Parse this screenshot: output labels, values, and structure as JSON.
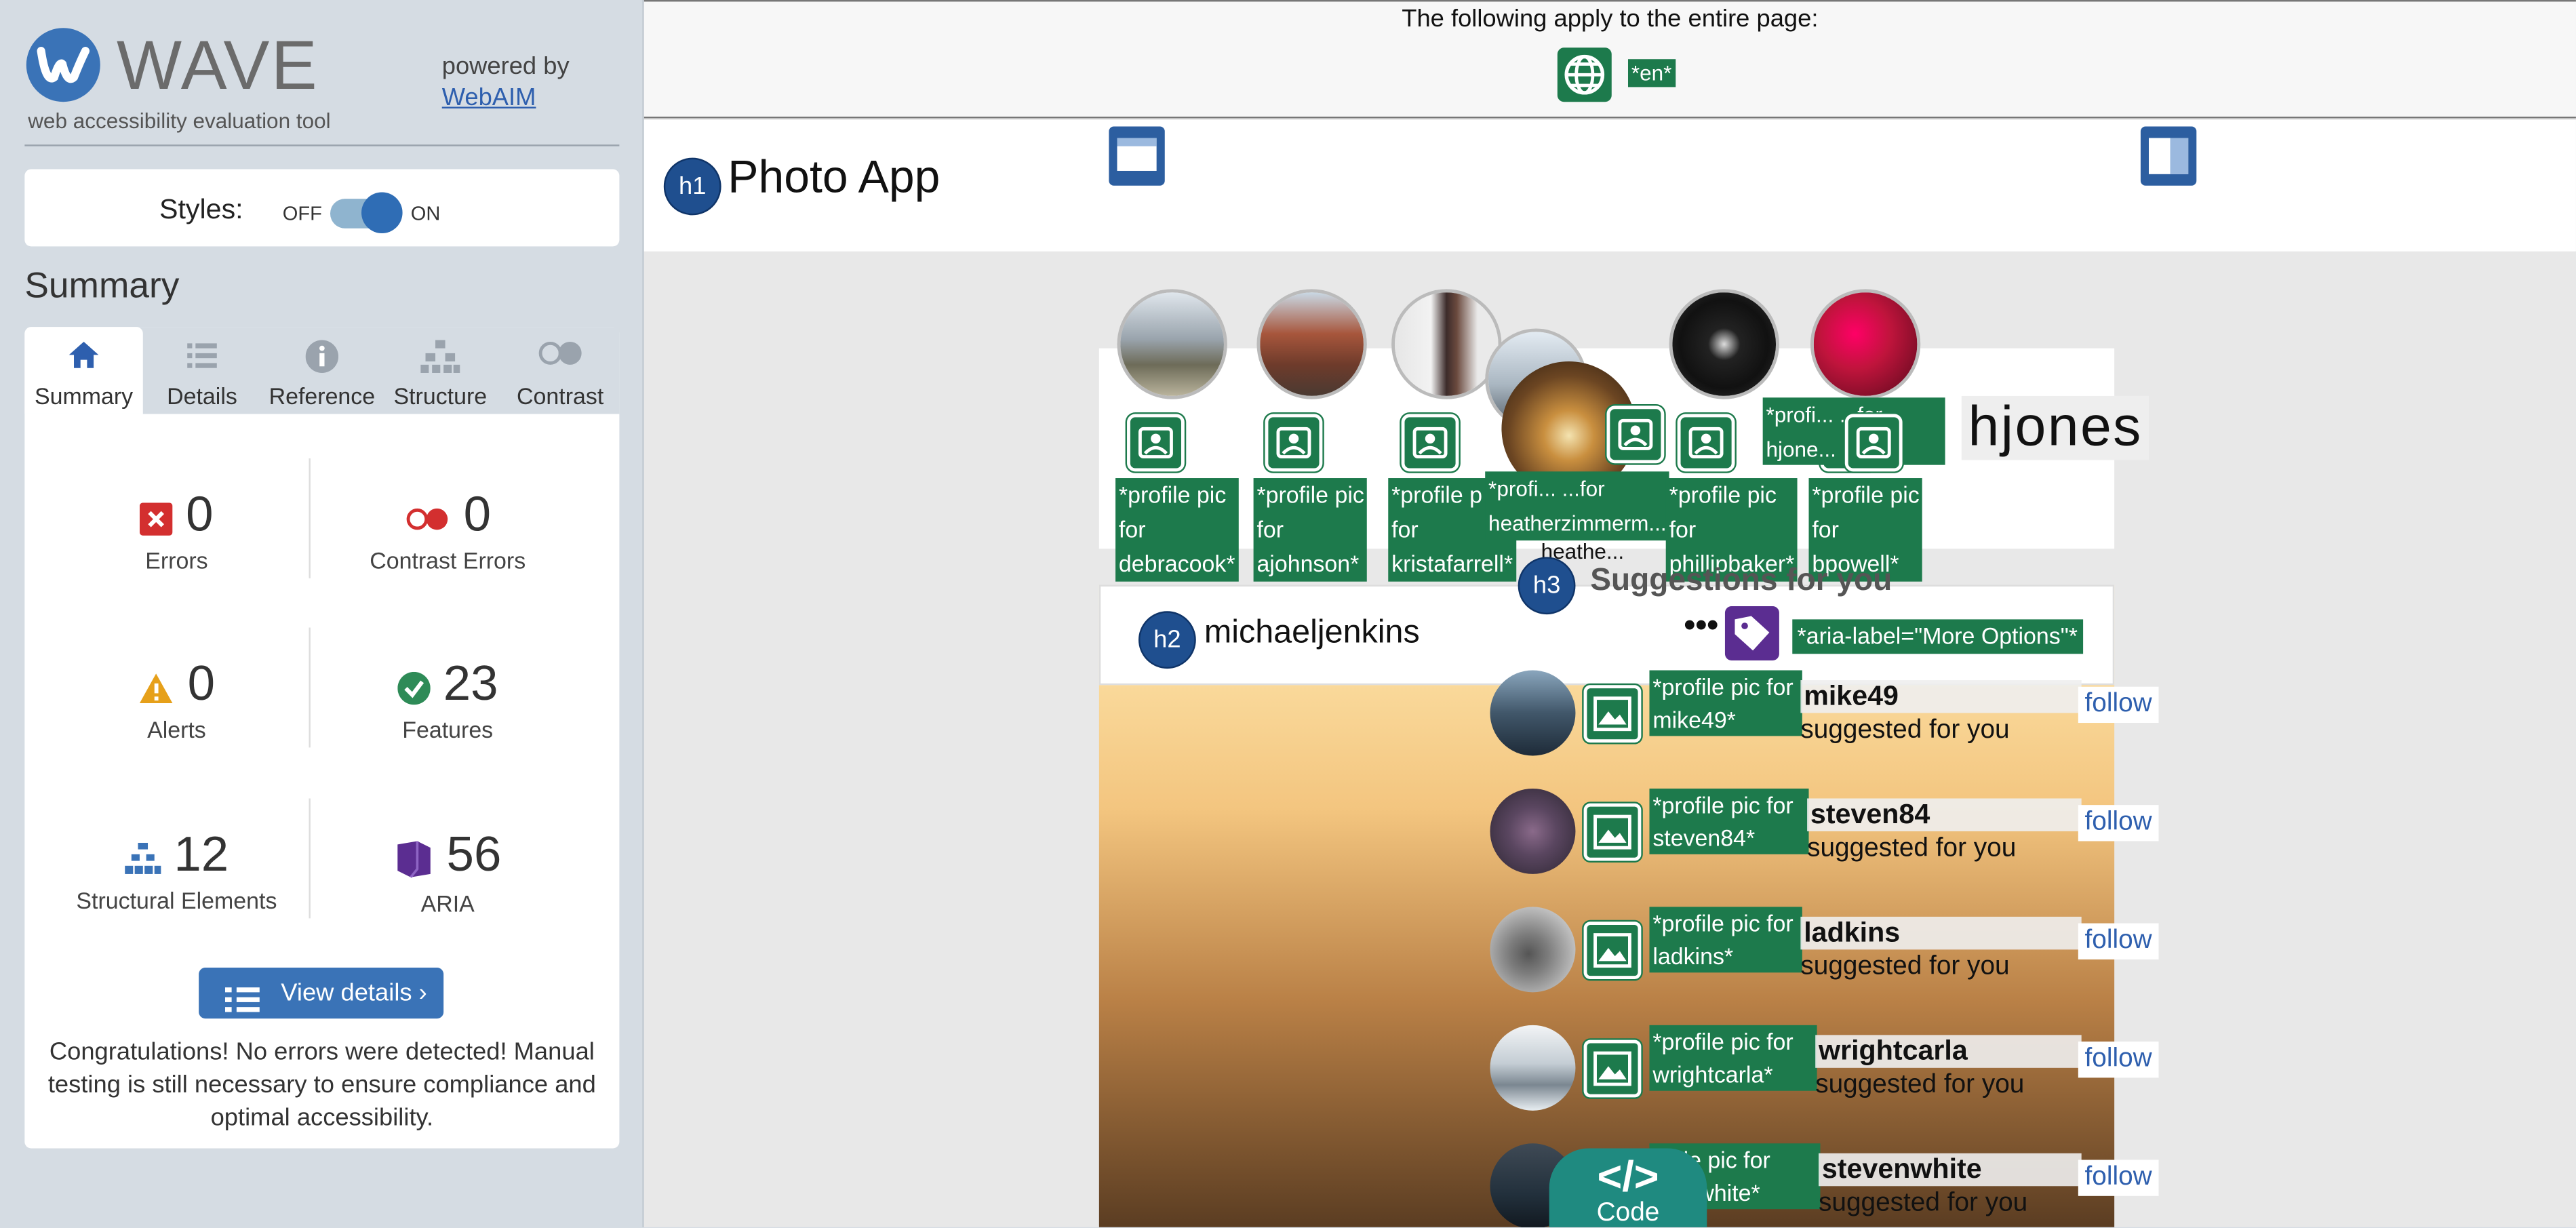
{
  "sidebar": {
    "title": "WAVE",
    "subtitle": "web accessibility evaluation tool",
    "powered_by": "powered by",
    "webaim_link": "WebAIM",
    "styles_label": "Styles:",
    "styles_off": "OFF",
    "styles_on": "ON",
    "styles_enabled": true,
    "summary_heading": "Summary",
    "tabs": [
      {
        "label": "Summary",
        "icon": "home-icon",
        "active": true
      },
      {
        "label": "Details",
        "icon": "list-icon",
        "active": false
      },
      {
        "label": "Reference",
        "icon": "info-icon",
        "active": false
      },
      {
        "label": "Structure",
        "icon": "hierarchy-icon",
        "active": false
      },
      {
        "label": "Contrast",
        "icon": "contrast-icon",
        "active": false
      }
    ],
    "stats": {
      "errors": {
        "value": "0",
        "label": "Errors",
        "color": "#d32f2f"
      },
      "contrast_errors": {
        "value": "0",
        "label": "Contrast Errors",
        "color": "#d32f2f"
      },
      "alerts": {
        "value": "0",
        "label": "Alerts",
        "color": "#e6a01a"
      },
      "features": {
        "value": "23",
        "label": "Features",
        "color": "#2e8b57"
      },
      "structural": {
        "value": "12",
        "label": "Structural Elements",
        "color": "#3a73b7"
      },
      "aria": {
        "value": "56",
        "label": "ARIA",
        "color": "#5b2d91"
      }
    },
    "view_details": "View details ›",
    "congrats": "Congratulations! No errors were detected! Manual testing is still necessary to ensure compliance and optimal accessibility."
  },
  "page": {
    "apply_text": "The following apply to the entire page:",
    "lang_tag": "*en*",
    "h1_badge": "h1",
    "app_title": "Photo App",
    "stories": [
      {
        "alt": "*profile pic for debracook*",
        "lines": [
          "*profile pic",
          "for",
          "debracook*"
        ]
      },
      {
        "alt": "*profile pic for ajohnson*",
        "lines": [
          "*profile pic",
          "for",
          "ajohnson*"
        ]
      },
      {
        "alt": "*profile pic for kristafarrell*",
        "lines": [
          "*profile p",
          "for",
          "kristafarrell*"
        ]
      },
      {
        "alt": "*profile pic for heatherzimmerman*",
        "lines": [
          "*profi... ...for",
          "heatherzimmerm..."
        ]
      },
      {
        "alt": "*profile pic for phillipbaker*",
        "lines": [
          "*profile pic",
          "for",
          "phillipbaker*"
        ]
      },
      {
        "alt": "*profile pic for bpowell*",
        "lines": [
          "*profile pic",
          "for",
          "bpowell*"
        ]
      }
    ],
    "hjones_label_lines": [
      "*profi... ...for",
      "hjone..."
    ],
    "hjones": "hjones",
    "heather_caption": "heathe...",
    "h3_badge": "h3",
    "suggestions_title": "Suggestions for you",
    "h2_badge": "h2",
    "post_user": "michaeljenkins",
    "more_options": "•••",
    "aria_label": "*aria-label=\"More Options\"*",
    "suggestions": [
      {
        "label_lines": [
          "*profile pic for",
          "mike49*"
        ],
        "name": "mike49",
        "sub": "suggested for you",
        "follow": "follow"
      },
      {
        "label_lines": [
          "*profile pic for",
          "steven84*"
        ],
        "name": "steven84",
        "sub": "suggested for you",
        "follow": "follow"
      },
      {
        "label_lines": [
          "*profile pic for",
          "ladkins*"
        ],
        "name": "ladkins",
        "sub": "suggested for you",
        "follow": "follow"
      },
      {
        "label_lines": [
          "*profile pic for",
          "wrightcarla*"
        ],
        "name": "wrightcarla",
        "sub": "suggested for you",
        "follow": "follow"
      },
      {
        "label_lines": [
          "...file pic for",
          "...enwhite*"
        ],
        "name": "stevenwhite",
        "sub": "suggested for you",
        "follow": "follow"
      }
    ],
    "code_icon": "</>",
    "code_label": "Code"
  }
}
